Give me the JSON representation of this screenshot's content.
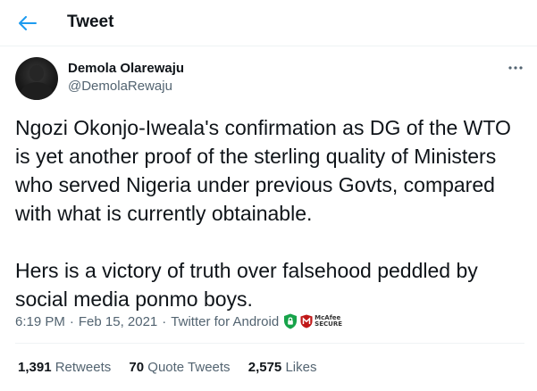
{
  "header": {
    "title": "Tweet",
    "back_icon": "arrow-left-icon"
  },
  "author": {
    "name": "Demola Olarewaju",
    "handle": "@DemolaRewaju"
  },
  "more_icon": "more-horizontal-icon",
  "tweet": {
    "paragraphs": [
      "Ngozi Okonjo-Iweala's confirmation as DG of the WTO is yet another proof of the sterling quality of Ministers who served Nigeria under previous Govts, compared with what is currently obtainable.",
      "Hers is a victory of truth over falsehood peddled by social media ponmo boys."
    ]
  },
  "meta": {
    "time": "6:19 PM",
    "separator": "·",
    "date": "Feb 15, 2021",
    "source": "Twitter for Android",
    "badge_line1": "McAfee",
    "badge_line2": "SECURE"
  },
  "stats": {
    "retweets_count": "1,391",
    "retweets_label": "Retweets",
    "quotes_count": "70",
    "quotes_label": "Quote Tweets",
    "likes_count": "2,575",
    "likes_label": "Likes"
  },
  "colors": {
    "accent": "#1d9bf0",
    "secondary_text": "#536471",
    "mcafee_red": "#c01818",
    "shield_green": "#17a34a"
  }
}
